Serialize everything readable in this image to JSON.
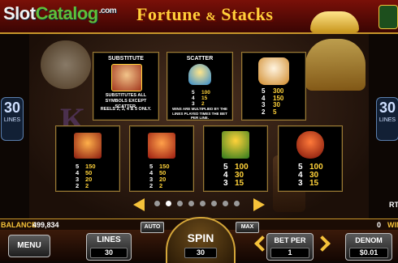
{
  "watermark": {
    "part1": "Slot",
    "part2": "Catalog",
    "suffix": ".com"
  },
  "game_title": {
    "main": "Fortune",
    "ampersand": "&",
    "second": "Stacks"
  },
  "side_lines": {
    "value": "30",
    "label": "LINES"
  },
  "paytable": {
    "substitute": {
      "caption": "SUBSTITUTE",
      "desc1": "SUBSTITUTES ALL SYMBOLS EXCEPT SCATTER.",
      "desc2": "REELS 2, 3, 4 & 5 ONLY."
    },
    "scatter": {
      "caption": "SCATTER",
      "pays": [
        {
          "count": "5",
          "value": "100"
        },
        {
          "count": "4",
          "value": "15"
        },
        {
          "count": "3",
          "value": "2"
        }
      ],
      "desc": "WINS ARE MULTIPLIED BY THE LINES PLAYED TIMES THE BET PER LINE."
    },
    "cat": {
      "pays": [
        {
          "count": "5",
          "value": "300"
        },
        {
          "count": "4",
          "value": "150"
        },
        {
          "count": "3",
          "value": "30"
        },
        {
          "count": "2",
          "value": "5"
        }
      ]
    },
    "row2": [
      {
        "pays": [
          {
            "count": "5",
            "value": "150"
          },
          {
            "count": "4",
            "value": "50"
          },
          {
            "count": "3",
            "value": "20"
          },
          {
            "count": "2",
            "value": "2"
          }
        ]
      },
      {
        "pays": [
          {
            "count": "5",
            "value": "150"
          },
          {
            "count": "4",
            "value": "50"
          },
          {
            "count": "3",
            "value": "20"
          },
          {
            "count": "2",
            "value": "2"
          }
        ]
      },
      {
        "pays": [
          {
            "count": "5",
            "value": "100"
          },
          {
            "count": "4",
            "value": "30"
          },
          {
            "count": "3",
            "value": "15"
          }
        ]
      },
      {
        "pays": [
          {
            "count": "5",
            "value": "100"
          },
          {
            "count": "4",
            "value": "30"
          },
          {
            "count": "3",
            "value": "15"
          }
        ]
      }
    ]
  },
  "page_dots": {
    "count": 8,
    "active": 1
  },
  "right_edge_label": "RT",
  "status": {
    "balance_label": "BALANCE",
    "balance_value": "499,834",
    "win_value": "0",
    "win_label": "WIN"
  },
  "controls": {
    "menu": "MENU",
    "auto": "AUTO",
    "max": "MAX",
    "lines_label": "LINES",
    "lines_value": "30",
    "spin_label": "SPIN",
    "spin_value": "30",
    "bet_label": "BET PER",
    "bet_value": "1",
    "denom_label": "DENOM",
    "denom_value": "$0.01"
  },
  "colors": {
    "gold": "#ffd23a",
    "title_red": "#7a1008"
  }
}
